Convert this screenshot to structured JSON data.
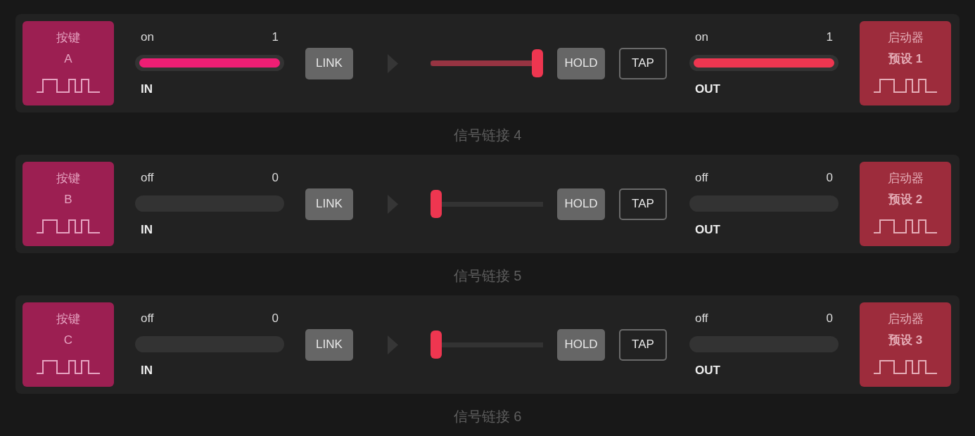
{
  "chains": [
    {
      "trigger": {
        "label": "按键",
        "key": "A"
      },
      "input": {
        "state": "on",
        "value": "1",
        "active": true,
        "label": "IN"
      },
      "link_button": "LINK",
      "slider": {
        "level": 1
      },
      "mode_buttons": [
        {
          "label": "HOLD",
          "kind": "filled"
        },
        {
          "label": "TAP",
          "kind": "outline"
        }
      ],
      "output": {
        "state": "on",
        "value": "1",
        "active": true,
        "label": "OUT"
      },
      "target": {
        "label": "启动器",
        "preset": "预设 1"
      }
    },
    {
      "title": "信号链接 4",
      "trigger": {
        "label": "按键",
        "key": "B"
      },
      "input": {
        "state": "off",
        "value": "0",
        "active": false,
        "label": "IN"
      },
      "link_button": "LINK",
      "slider": {
        "level": 0
      },
      "mode_buttons": [
        {
          "label": "HOLD",
          "kind": "filled"
        },
        {
          "label": "TAP",
          "kind": "outline"
        }
      ],
      "output": {
        "state": "off",
        "value": "0",
        "active": false,
        "label": "OUT"
      },
      "target": {
        "label": "启动器",
        "preset": "预设 2"
      }
    },
    {
      "title": "信号链接 5",
      "trigger": {
        "label": "按键",
        "key": "C"
      },
      "input": {
        "state": "off",
        "value": "0",
        "active": false,
        "label": "IN"
      },
      "link_button": "LINK",
      "slider": {
        "level": 0
      },
      "mode_buttons": [
        {
          "label": "HOLD",
          "kind": "filled"
        },
        {
          "label": "TAP",
          "kind": "outline"
        }
      ],
      "output": {
        "state": "off",
        "value": "0",
        "active": false,
        "label": "OUT"
      },
      "target": {
        "label": "启动器",
        "preset": "预设 3"
      }
    },
    {
      "title": "信号链接 6"
    }
  ]
}
